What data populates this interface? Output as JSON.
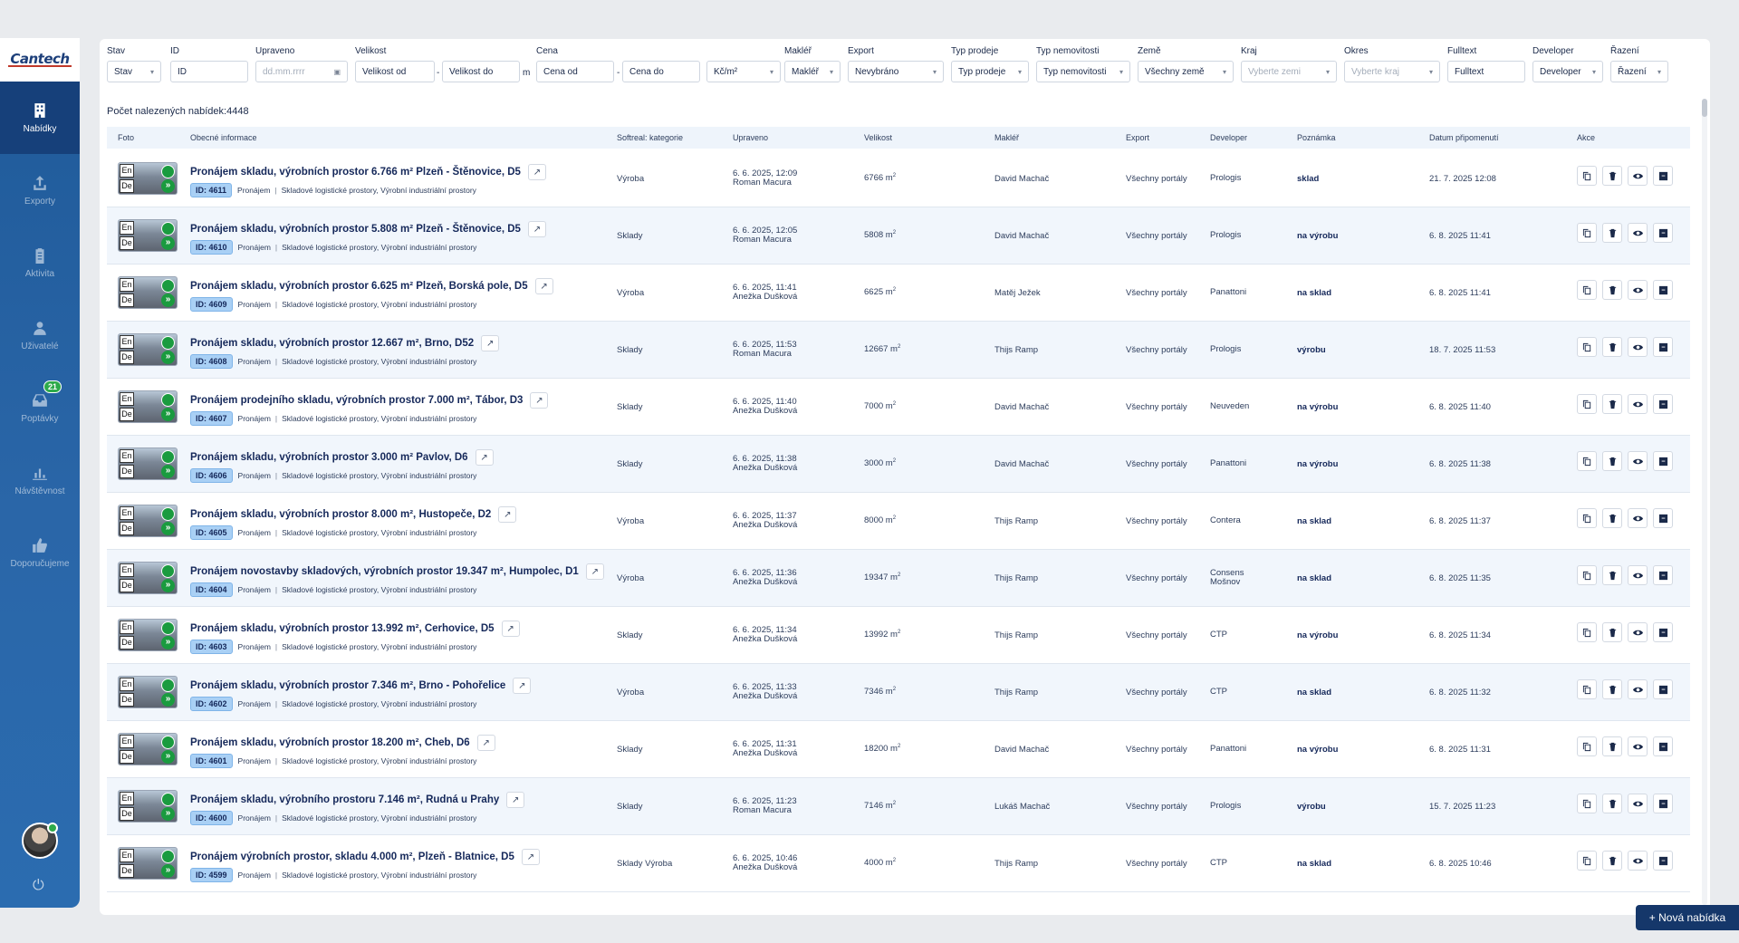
{
  "app": {
    "logo_text": "Cantech"
  },
  "sidebar": {
    "items": [
      {
        "label": "Nabídky",
        "icon": "building-icon",
        "active": true
      },
      {
        "label": "Exporty",
        "icon": "upload-icon",
        "active": false
      },
      {
        "label": "Aktivita",
        "icon": "clipboard-icon",
        "active": false
      },
      {
        "label": "Uživatelé",
        "icon": "user-icon",
        "active": false
      },
      {
        "label": "Poptávky",
        "icon": "inbox-icon",
        "active": false,
        "badge": "21"
      },
      {
        "label": "Návštěvnost",
        "icon": "bar-chart-icon",
        "active": false
      },
      {
        "label": "Doporučujeme",
        "icon": "thumbs-up-icon",
        "active": false
      }
    ]
  },
  "filters": {
    "stav": {
      "label": "Stav",
      "value": "Stav"
    },
    "id": {
      "label": "ID",
      "value": "ID"
    },
    "upraveno": {
      "label": "Upraveno",
      "placeholder": "dd.mm.rrrr"
    },
    "velikost": {
      "label": "Velikost",
      "from": "Velikost od",
      "to": "Velikost do",
      "unit": "m"
    },
    "cena": {
      "label": "Cena",
      "from": "Cena od",
      "to": "Cena do",
      "currency": "Kč/m²"
    },
    "makler": {
      "label": "Makléř",
      "value": "Makléř"
    },
    "export": {
      "label": "Export",
      "value": "Nevybráno"
    },
    "typ_prodeje": {
      "label": "Typ prodeje",
      "value": "Typ prodeje"
    },
    "typ_nemovitosti": {
      "label": "Typ nemovitosti",
      "value": "Typ nemovitosti"
    },
    "zeme": {
      "label": "Země",
      "value": "Všechny země"
    },
    "kraj": {
      "label": "Kraj",
      "value": "Vyberte zemi"
    },
    "okres": {
      "label": "Okres",
      "value": "Vyberte kraj"
    },
    "fulltext": {
      "label": "Fulltext",
      "value": "Fulltext"
    },
    "developer": {
      "label": "Developer",
      "value": "Developer"
    },
    "razeni": {
      "label": "Řazení",
      "value": "Řazení"
    }
  },
  "results": {
    "count_label": "Počet nalezených nabídek:4448"
  },
  "table": {
    "columns": {
      "foto": "Foto",
      "info": "Obecné informace",
      "category": "Softreal: kategorie",
      "updated": "Upraveno",
      "size": "Velikost",
      "broker": "Makléř",
      "export": "Export",
      "developer": "Developer",
      "note": "Poznámka",
      "reminder": "Datum připomenutí",
      "actions": "Akce"
    },
    "lang_en": "En",
    "lang_de": "De",
    "rows": [
      {
        "title": "Pronájem skladu, výrobních prostor 6.766 m² Plzeň - Štěnovice, D5",
        "id": "ID: 4611",
        "type": "Pronájem",
        "tags": "Skladové logistické prostory, Výrobní industriální prostory",
        "category": "Výroba",
        "updated_date": "6. 6. 2025, 12:09",
        "updated_by": "Roman Macura",
        "size": "6766 m",
        "broker": "David Machač",
        "export": "Všechny portály",
        "developer": "Prologis",
        "developer2": "",
        "note": "sklad",
        "reminder": "21. 7. 2025 12:08"
      },
      {
        "title": "Pronájem skladu, výrobních prostor 5.808 m² Plzeň - Štěnovice, D5",
        "id": "ID: 4610",
        "type": "Pronájem",
        "tags": "Skladové logistické prostory, Výrobní industriální prostory",
        "category": "Sklady",
        "updated_date": "6. 6. 2025, 12:05",
        "updated_by": "Roman Macura",
        "size": "5808 m",
        "broker": "David Machač",
        "export": "Všechny portály",
        "developer": "Prologis",
        "developer2": "",
        "note": "na výrobu",
        "reminder": "6. 8. 2025 11:41"
      },
      {
        "title": "Pronájem skladu, výrobních prostor 6.625 m² Plzeň, Borská pole, D5",
        "id": "ID: 4609",
        "type": "Pronájem",
        "tags": "Skladové logistické prostory, Výrobní industriální prostory",
        "category": "Výroba",
        "updated_date": "6. 6. 2025, 11:41",
        "updated_by": "Anežka Dušková",
        "size": "6625 m",
        "broker": "Matěj Ježek",
        "export": "Všechny portály",
        "developer": "Panattoni",
        "developer2": "",
        "note": "na sklad",
        "reminder": "6. 8. 2025 11:41"
      },
      {
        "title": "Pronájem skladu, výrobních prostor 12.667 m², Brno, D52",
        "id": "ID: 4608",
        "type": "Pronájem",
        "tags": "Skladové logistické prostory, Výrobní industriální prostory",
        "category": "Sklady",
        "updated_date": "6. 6. 2025, 11:53",
        "updated_by": "Roman Macura",
        "size": "12667 m",
        "broker": "Thijs Ramp",
        "export": "Všechny portály",
        "developer": "Prologis",
        "developer2": "",
        "note": "výrobu",
        "reminder": "18. 7. 2025 11:53"
      },
      {
        "title": "Pronájem prodejního skladu, výrobních prostor 7.000 m², Tábor, D3",
        "id": "ID: 4607",
        "type": "Pronájem",
        "tags": "Skladové logistické prostory, Výrobní industriální prostory",
        "category": "Sklady",
        "updated_date": "6. 6. 2025, 11:40",
        "updated_by": "Anežka Dušková",
        "size": "7000 m",
        "broker": "David Machač",
        "export": "Všechny portály",
        "developer": "Neuveden",
        "developer2": "",
        "note": "na výrobu",
        "reminder": "6. 8. 2025 11:40"
      },
      {
        "title": "Pronájem skladu, výrobních prostor 3.000 m² Pavlov, D6",
        "id": "ID: 4606",
        "type": "Pronájem",
        "tags": "Skladové logistické prostory, Výrobní industriální prostory",
        "category": "Sklady",
        "updated_date": "6. 6. 2025, 11:38",
        "updated_by": "Anežka Dušková",
        "size": "3000 m",
        "broker": "David Machač",
        "export": "Všechny portály",
        "developer": "Panattoni",
        "developer2": "",
        "note": "na výrobu",
        "reminder": "6. 8. 2025 11:38"
      },
      {
        "title": "Pronájem skladu, výrobních prostor 8.000 m², Hustopeče, D2",
        "id": "ID: 4605",
        "type": "Pronájem",
        "tags": "Skladové logistické prostory, Výrobní industriální prostory",
        "category": "Výroba",
        "updated_date": "6. 6. 2025, 11:37",
        "updated_by": "Anežka Dušková",
        "size": "8000 m",
        "broker": "Thijs Ramp",
        "export": "Všechny portály",
        "developer": "Contera",
        "developer2": "",
        "note": "na sklad",
        "reminder": "6. 8. 2025 11:37"
      },
      {
        "title": "Pronájem novostavby skladových, výrobních prostor 19.347 m², Humpolec, D1",
        "id": "ID: 4604",
        "type": "Pronájem",
        "tags": "Skladové logistické prostory, Výrobní industriální prostory",
        "category": "Výroba",
        "updated_date": "6. 6. 2025, 11:36",
        "updated_by": "Anežka Dušková",
        "size": "19347 m",
        "broker": "Thijs Ramp",
        "export": "Všechny portály",
        "developer": "Consens",
        "developer2": "Mošnov",
        "note": "na sklad",
        "reminder": "6. 8. 2025 11:35"
      },
      {
        "title": "Pronájem skladu, výrobních prostor 13.992 m², Cerhovice, D5",
        "id": "ID: 4603",
        "type": "Pronájem",
        "tags": "Skladové logistické prostory, Výrobní industriální prostory",
        "category": "Sklady",
        "updated_date": "6. 6. 2025, 11:34",
        "updated_by": "Anežka Dušková",
        "size": "13992 m",
        "broker": "Thijs Ramp",
        "export": "Všechny portály",
        "developer": "CTP",
        "developer2": "",
        "note": "na výrobu",
        "reminder": "6. 8. 2025 11:34"
      },
      {
        "title": "Pronájem skladu, výrobních prostor 7.346 m², Brno - Pohořelice",
        "id": "ID: 4602",
        "type": "Pronájem",
        "tags": "Skladové logistické prostory, Výrobní industriální prostory",
        "category": "Výroba",
        "updated_date": "6. 6. 2025, 11:33",
        "updated_by": "Anežka Dušková",
        "size": "7346 m",
        "broker": "Thijs Ramp",
        "export": "Všechny portály",
        "developer": "CTP",
        "developer2": "",
        "note": "na sklad",
        "reminder": "6. 8. 2025 11:32"
      },
      {
        "title": "Pronájem skladu, výrobních prostor 18.200 m², Cheb, D6",
        "id": "ID: 4601",
        "type": "Pronájem",
        "tags": "Skladové logistické prostory, Výrobní industriální prostory",
        "category": "Sklady",
        "updated_date": "6. 6. 2025, 11:31",
        "updated_by": "Anežka Dušková",
        "size": "18200 m",
        "broker": "David Machač",
        "export": "Všechny portály",
        "developer": "Panattoni",
        "developer2": "",
        "note": "na výrobu",
        "reminder": "6. 8. 2025 11:31"
      },
      {
        "title": "Pronájem skladu, výrobního prostoru 7.146 m², Rudná u Prahy",
        "id": "ID: 4600",
        "type": "Pronájem",
        "tags": "Skladové logistické prostory, Výrobní industriální prostory",
        "category": "Sklady",
        "updated_date": "6. 6. 2025, 11:23",
        "updated_by": "Roman Macura",
        "size": "7146 m",
        "broker": "Lukáš Machač",
        "export": "Všechny portály",
        "developer": "Prologis",
        "developer2": "",
        "note": "výrobu",
        "reminder": "15. 7. 2025 11:23"
      },
      {
        "title": "Pronájem výrobních prostor, skladu 4.000 m², Plzeň - Blatnice, D5",
        "id": "ID: 4599",
        "type": "Pronájem",
        "tags": "Skladové logistické prostory, Výrobní industriální prostory",
        "category": "Sklady Výroba",
        "updated_date": "6. 6. 2025, 10:46",
        "updated_by": "Anežka Dušková",
        "size": "4000 m",
        "broker": "Thijs Ramp",
        "export": "Všechny portály",
        "developer": "CTP",
        "developer2": "",
        "note": "na sklad",
        "reminder": "6. 8. 2025 10:46"
      }
    ]
  },
  "new_button": {
    "label": "+ Nová nabídka"
  },
  "colors": {
    "accent": "#15376a",
    "sidebar": "#1f5a99",
    "badge": "#2eaa4a"
  }
}
